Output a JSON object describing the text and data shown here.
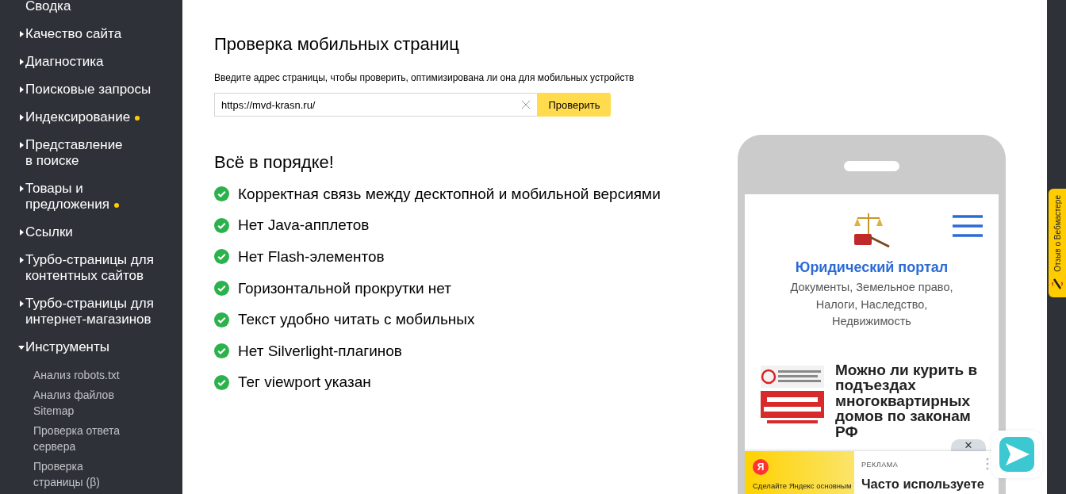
{
  "sidebar": {
    "items": [
      {
        "label": "Сводка",
        "kind": "plain",
        "dot": false
      },
      {
        "label": "Качество сайта",
        "kind": "group",
        "expanded": false,
        "dot": false
      },
      {
        "label": "Диагностика",
        "kind": "group",
        "expanded": false,
        "dot": false
      },
      {
        "label": "Поисковые запросы",
        "kind": "group",
        "expanded": false,
        "dot": false
      },
      {
        "label": "Индексирование",
        "kind": "group",
        "expanded": false,
        "dot": true
      },
      {
        "label": "Представление\nв поиске",
        "kind": "group",
        "expanded": false,
        "dot": false
      },
      {
        "label": "Товары и предложения",
        "kind": "group",
        "expanded": false,
        "dot": true
      },
      {
        "label": "Ссылки",
        "kind": "group",
        "expanded": false,
        "dot": false
      },
      {
        "label": "Турбо-страницы для контентных сайтов",
        "kind": "group",
        "expanded": false,
        "dot": false
      },
      {
        "label": "Турбо-страницы для интернет-магазинов",
        "kind": "group",
        "expanded": false,
        "dot": false
      },
      {
        "label": "Инструменты",
        "kind": "group",
        "expanded": true,
        "dot": false,
        "children": [
          {
            "label": "Анализ robots.txt"
          },
          {
            "label": "Анализ файлов Sitemap"
          },
          {
            "label": "Проверка ответа сервера"
          },
          {
            "label": "Проверка страницы (β)"
          }
        ]
      }
    ]
  },
  "page": {
    "title": "Проверка мобильных страниц",
    "hint": "Введите адрес страницы, чтобы проверить, оптимизирована ли она для мобильных устройств",
    "url": "https://mvd-krasn.ru/",
    "check_button": "Проверить",
    "result_title": "Всё в порядке!",
    "checks": [
      {
        "label": "Корректная связь между десктопной и мобильной версиями",
        "passed": true
      },
      {
        "label": "Нет Java-апплетов",
        "passed": true
      },
      {
        "label": "Нет Flash-элементов",
        "passed": true
      },
      {
        "label": "Горизонтальной прокрутки нет",
        "passed": true
      },
      {
        "label": "Текст удобно читать с мобильных",
        "passed": true
      },
      {
        "label": "Нет Silverlight-плагинов",
        "passed": true
      },
      {
        "label": "Тег viewport указан",
        "passed": true
      }
    ]
  },
  "phone_preview": {
    "site_title": "Юридический портал",
    "site_subtitle": "Документы, Земельное право, Налоги, Наследство, Недвижимость",
    "article_title": "Можно ли курить в подъездах многоквартирных домов по законам РФ",
    "close": "✕",
    "ad": {
      "logo": "Я",
      "banner_text": "Сделайте Яндекс основным",
      "label": "РЕКЛАМА",
      "title": "Часто используете"
    }
  },
  "feedback_tab": "Отзыв о Вебмастере"
}
